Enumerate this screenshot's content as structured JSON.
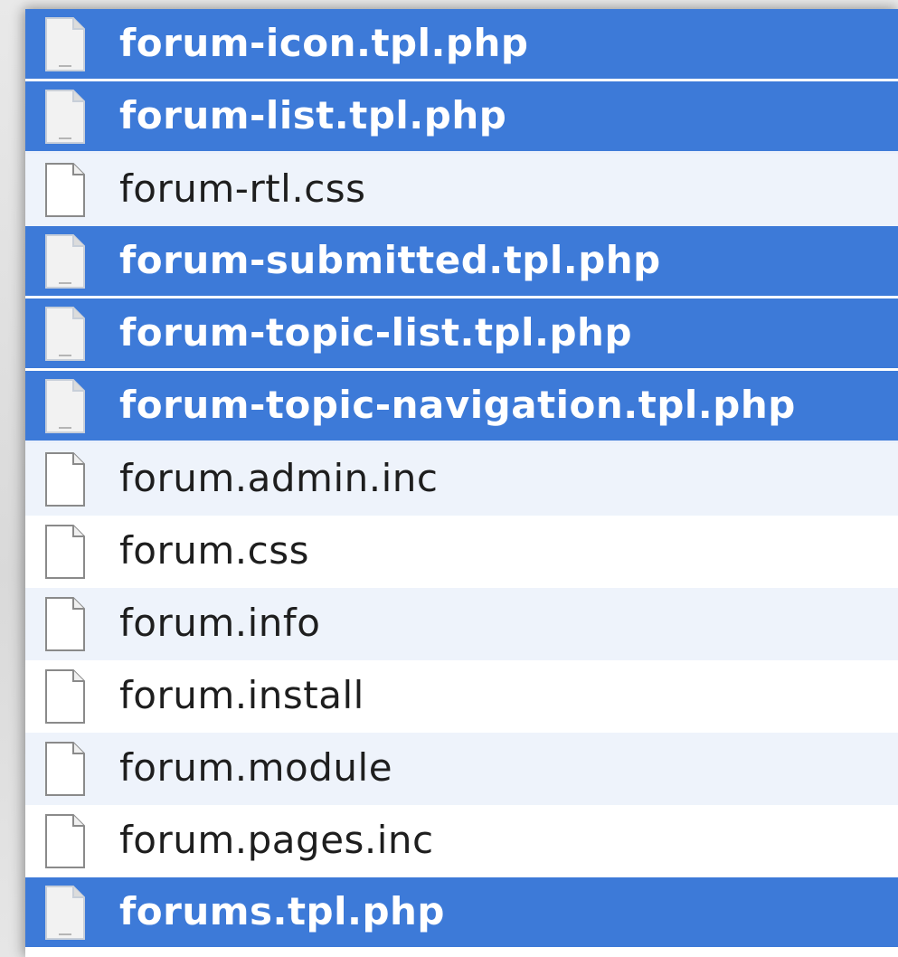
{
  "colors": {
    "selected_row": "#3d7ad8",
    "alternate_row": "#eef3fb",
    "row": "#ffffff",
    "text": "#1e1e1e",
    "selected_text": "#ffffff"
  },
  "files": [
    {
      "name": "forum-icon.tpl.php",
      "selected": true,
      "icon": "document-icon"
    },
    {
      "name": "forum-list.tpl.php",
      "selected": true,
      "icon": "document-icon"
    },
    {
      "name": "forum-rtl.css",
      "selected": false,
      "icon": "document-icon"
    },
    {
      "name": "forum-submitted.tpl.php",
      "selected": true,
      "icon": "document-icon"
    },
    {
      "name": "forum-topic-list.tpl.php",
      "selected": true,
      "icon": "document-icon"
    },
    {
      "name": "forum-topic-navigation.tpl.php",
      "selected": true,
      "icon": "document-icon"
    },
    {
      "name": "forum.admin.inc",
      "selected": false,
      "icon": "document-icon"
    },
    {
      "name": "forum.css",
      "selected": false,
      "icon": "document-icon"
    },
    {
      "name": "forum.info",
      "selected": false,
      "icon": "document-icon"
    },
    {
      "name": "forum.install",
      "selected": false,
      "icon": "document-icon"
    },
    {
      "name": "forum.module",
      "selected": false,
      "icon": "document-icon"
    },
    {
      "name": "forum.pages.inc",
      "selected": false,
      "icon": "document-icon"
    },
    {
      "name": "forums.tpl.php",
      "selected": true,
      "icon": "document-icon"
    }
  ]
}
